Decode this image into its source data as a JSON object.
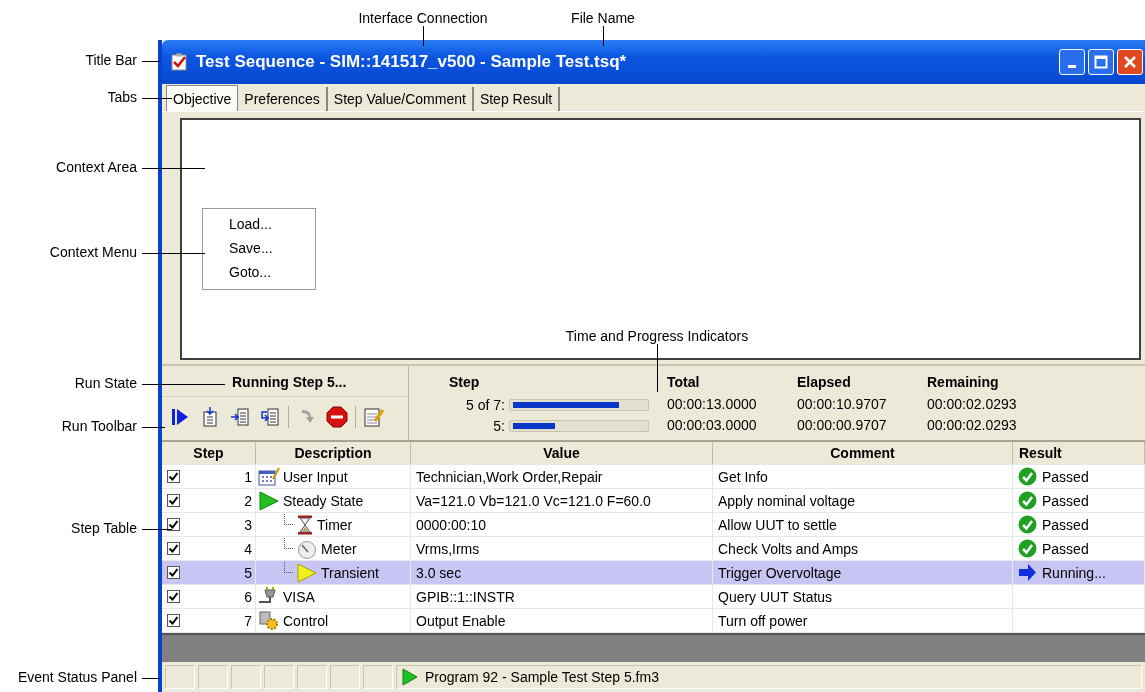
{
  "annotations": [
    {
      "text": "Interface Connection"
    },
    {
      "text": "File Name"
    },
    {
      "text": "Title Bar"
    },
    {
      "text": "Tabs"
    },
    {
      "text": "Context Area"
    },
    {
      "text": "Context Menu"
    },
    {
      "text": "Time and Progress Indicators"
    },
    {
      "text": "Run State"
    },
    {
      "text": "Run Toolbar"
    },
    {
      "text": "Step Table"
    },
    {
      "text": "Event Status Panel"
    }
  ],
  "window": {
    "title": "Test Sequence - SIM::141517_v500 - Sample Test.tsq*"
  },
  "tabs": [
    {
      "label": "Objective",
      "selected": true
    },
    {
      "label": "Preferences",
      "selected": false
    },
    {
      "label": "Step Value/Comment",
      "selected": false
    },
    {
      "label": "Step Result",
      "selected": false
    }
  ],
  "context_menu": [
    "Load...",
    "Save...",
    "Goto..."
  ],
  "run_state": "Running Step 5...",
  "toolbar": [
    {
      "kind": "run",
      "disabled": false
    },
    {
      "kind": "step-into",
      "disabled": false
    },
    {
      "kind": "step-over",
      "disabled": false
    },
    {
      "kind": "loop",
      "disabled": false
    },
    {
      "kind": "skip",
      "disabled": true
    },
    {
      "kind": "stop",
      "disabled": false
    },
    {
      "kind": "notes",
      "disabled": false
    }
  ],
  "progress": {
    "step_header": "Step",
    "total_header": "Total",
    "elapsed_header": "Elapsed",
    "remaining_header": "Remaining",
    "rows": [
      {
        "label": "5 of 7:",
        "level": 0.8,
        "total": "00:00:13.0000",
        "elapsed": "00:00:10.9707",
        "remaining": "00:00:02.0293"
      },
      {
        "label": "5:",
        "level": 0.32,
        "total": "00:00:03.0000",
        "elapsed": "00:00:00.9707",
        "remaining": "00:00:02.0293"
      }
    ]
  },
  "table": {
    "columns": [
      "Step",
      "Description",
      "Value",
      "Comment",
      "Result"
    ],
    "rows": [
      {
        "step": "1",
        "checked": true,
        "selected": false,
        "kind": "user-input",
        "description": "User Input",
        "value": "Technician,Work Order,Repair",
        "comment": "Get Info",
        "result": {
          "kind": "passed",
          "text": "Passed"
        }
      },
      {
        "step": "2",
        "checked": true,
        "selected": false,
        "kind": "steady-state",
        "description": "Steady State",
        "value": "Va=121.0 Vb=121.0 Vc=121.0 F=60.0",
        "comment": "Apply nominal voltage",
        "result": {
          "kind": "passed",
          "text": "Passed"
        },
        "children": [
          {
            "step": "3",
            "checked": true,
            "selected": false,
            "kind": "timer",
            "description": "Timer",
            "value": "0000:00:10",
            "comment": "Allow UUT to settle",
            "result": {
              "kind": "passed",
              "text": "Passed"
            }
          },
          {
            "step": "4",
            "checked": true,
            "selected": false,
            "kind": "meter",
            "description": "Meter",
            "value": "Vrms,Irms",
            "comment": "Check Volts and Amps",
            "result": {
              "kind": "passed",
              "text": "Passed"
            }
          },
          {
            "step": "5",
            "checked": true,
            "selected": true,
            "kind": "transient",
            "description": "Transient",
            "value": "3.0 sec",
            "comment": "Trigger Overvoltage",
            "result": {
              "kind": "running",
              "text": "Running..."
            }
          }
        ]
      },
      {
        "step": "6",
        "checked": true,
        "selected": false,
        "kind": "visa",
        "description": "VISA",
        "value": "GPIB::1::INSTR",
        "comment": "Query UUT Status"
      },
      {
        "step": "7",
        "checked": true,
        "selected": false,
        "kind": "control",
        "description": "Control",
        "value": "Output Enable",
        "comment": "Turn off power"
      }
    ]
  },
  "status_bar": {
    "text": "Program 92 - Sample Test Step 5.fm3"
  }
}
